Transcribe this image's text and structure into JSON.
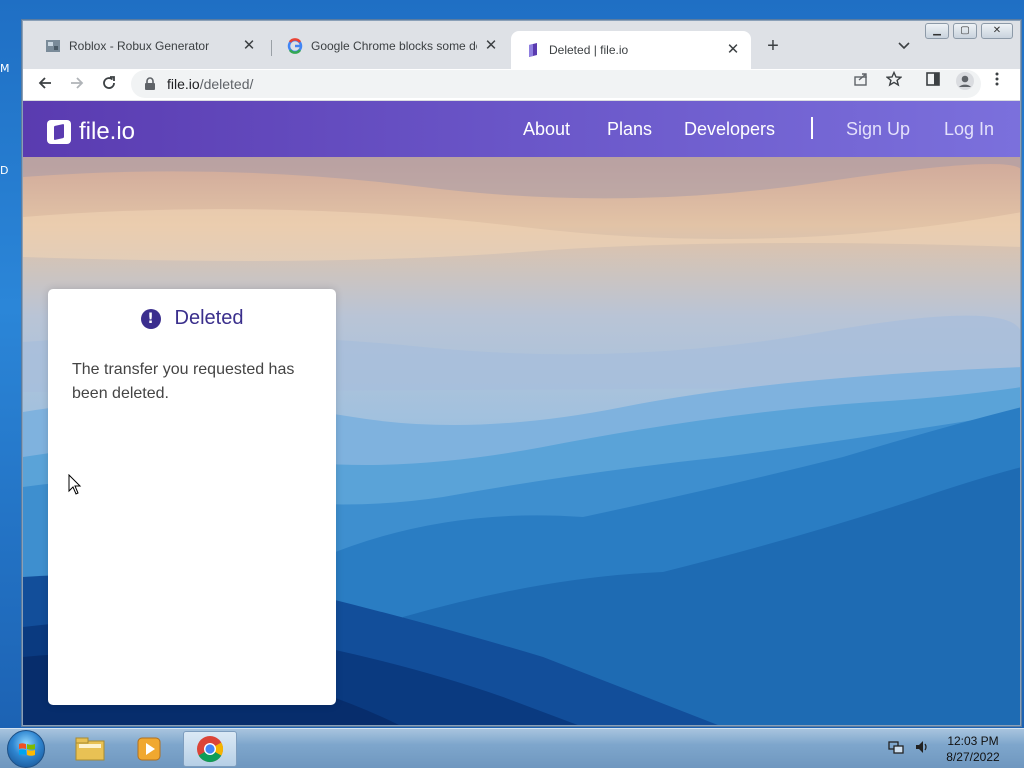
{
  "desktop": {
    "edge_letters": [
      "M",
      "D"
    ]
  },
  "browser": {
    "tabs": [
      {
        "title": "Roblox - Robux Generator",
        "active": false
      },
      {
        "title": "Google Chrome blocks some dov",
        "active": false
      },
      {
        "title": "Deleted | file.io",
        "active": true
      }
    ],
    "new_tab_symbol": "+",
    "close_symbol": "✕",
    "address": {
      "host": "file.io",
      "path": "/deleted/"
    }
  },
  "site": {
    "logo_text": "file.io",
    "nav": {
      "about": "About",
      "plans": "Plans",
      "developers": "Developers",
      "signup": "Sign Up",
      "login": "Log In"
    },
    "card": {
      "icon_glyph": "!",
      "title": "Deleted",
      "message": "The transfer you requested has been deleted."
    },
    "colors": {
      "nav_start": "#5a3bb0",
      "nav_end": "#7b70dc",
      "accent": "#3a2f8c"
    }
  },
  "taskbar": {
    "time": "12:03 PM",
    "date": "8/27/2022",
    "pinned": [
      "file-explorer-icon",
      "media-player-icon",
      "chrome-icon"
    ]
  }
}
